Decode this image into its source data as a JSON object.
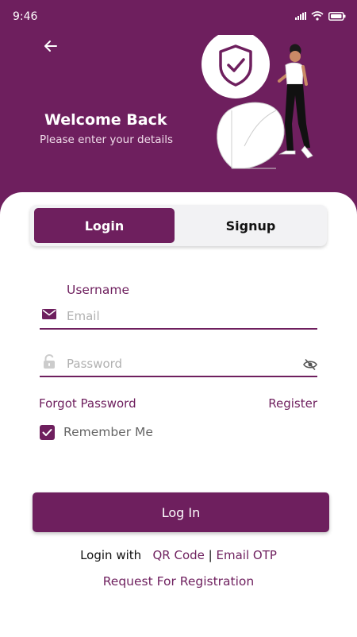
{
  "status_bar": {
    "time": "9:46",
    "icons": [
      "signal-icon",
      "wifi-icon",
      "battery-icon"
    ]
  },
  "header": {
    "back_icon": "arrow-left-icon",
    "title": "Welcome Back",
    "subtitle": "Please enter your details",
    "illustration_icon": "shield-check-icon"
  },
  "tabs": [
    {
      "label": "Login",
      "active": true
    },
    {
      "label": "Signup",
      "active": false
    }
  ],
  "form": {
    "username_label": "Username",
    "email_placeholder": "Email",
    "email_icon": "envelope-icon",
    "email_value": "",
    "password_placeholder": "Password",
    "password_icon": "lock-icon",
    "password_value": "",
    "visibility_icon": "eye-off-icon",
    "forgot_label": "Forgot Password",
    "register_label": "Register",
    "remember_label": "Remember Me",
    "remember_checked": true,
    "submit_label": "Log In"
  },
  "footer": {
    "login_with": "Login with",
    "qr_code": "QR Code",
    "separator": "|",
    "email_otp": "Email OTP",
    "request": "Request For Registration"
  },
  "colors": {
    "primary": "#6E1F5E",
    "background": "#FFFFFF",
    "placeholder": "#B0B0B0",
    "tab_inactive_bg": "#F2F2F4"
  }
}
